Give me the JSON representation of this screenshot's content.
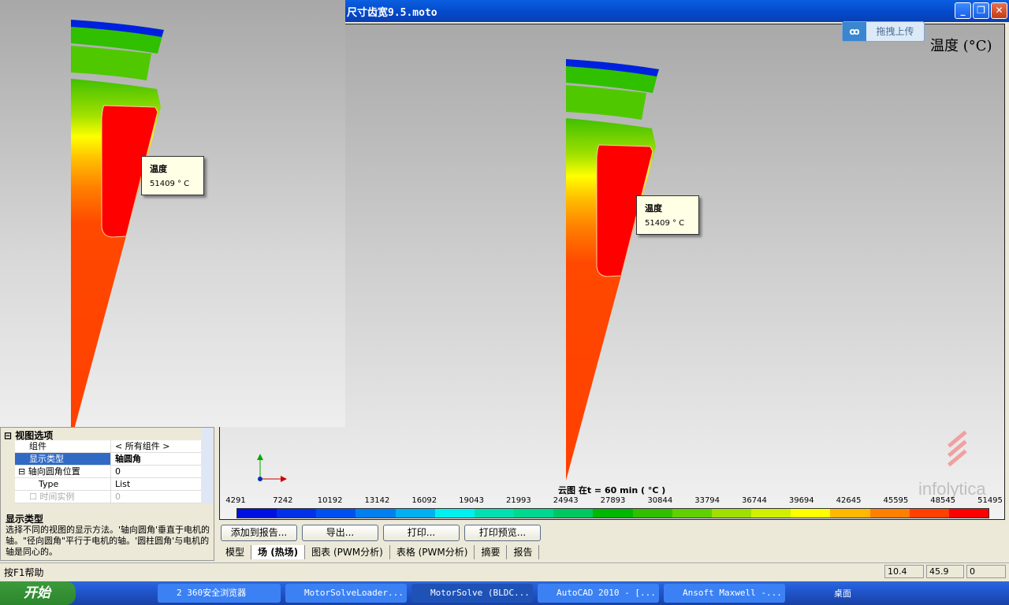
{
  "window": {
    "title": "尺寸齿宽9.5.moto",
    "minimize": "_",
    "restore": "❐",
    "close": "✕"
  },
  "upload": {
    "icon": "cloud-link-icon",
    "label": "拖拽上传"
  },
  "view": {
    "unit_label": "温度 (°C)",
    "tooltip": {
      "title": "温度",
      "value": "51409 ° C"
    },
    "colorbar_title": "云图 在t = 60 min ( °C )",
    "colorbar_labels": [
      "4291",
      "7242",
      "10192",
      "13142",
      "16092",
      "19043",
      "21993",
      "24943",
      "27893",
      "30844",
      "33794",
      "36744",
      "39694",
      "42645",
      "45595",
      "48545",
      "51495"
    ],
    "colorbar_colors": [
      "#0010e0",
      "#0030e8",
      "#0050f0",
      "#0080f0",
      "#00b0f0",
      "#00f0f0",
      "#00e0b0",
      "#00d890",
      "#00c860",
      "#00b800",
      "#30c000",
      "#60d000",
      "#a0e000",
      "#d0f000",
      "#ffff00",
      "#ffb800",
      "#ff8000",
      "#ff4000",
      "#ff0000"
    ],
    "watermark": "infolytica"
  },
  "buttons": {
    "add_report": "添加到报告...",
    "export": "导出...",
    "print": "打印...",
    "print_preview": "打印预览..."
  },
  "tabs": [
    "模型",
    "场 (热场)",
    "图表 (PWM分析)",
    "表格 (PWM分析)",
    "摘要",
    "报告"
  ],
  "properties": {
    "section": "视图选项",
    "rows": [
      {
        "key": "组件",
        "value": "< 所有组件 >"
      },
      {
        "key": "显示类型",
        "value": "轴圆角"
      },
      {
        "key": "轴向圆角位置",
        "value": "0"
      },
      {
        "key": "Type",
        "value": "List"
      },
      {
        "key": "时间实例",
        "value": "0"
      }
    ],
    "help_title": "显示类型",
    "help_text": "选择不同的视图的显示方法。'轴向圆角'垂直于电机的轴。\"径向圆角\"平行于电机的轴。'圆柱圆角'与电机的轴是同心的。"
  },
  "status": {
    "help": "按F1帮助",
    "v1": "10.4",
    "v2": "45.9",
    "v3": "0"
  },
  "taskbar": {
    "start": "开始",
    "tasks": [
      "2 360安全浏览器",
      "MotorSolveLoader...",
      "MotorSolve (BLDC...",
      "AutoCAD 2010 - [...",
      "Ansoft Maxwell -..."
    ],
    "tray": "桌面"
  }
}
